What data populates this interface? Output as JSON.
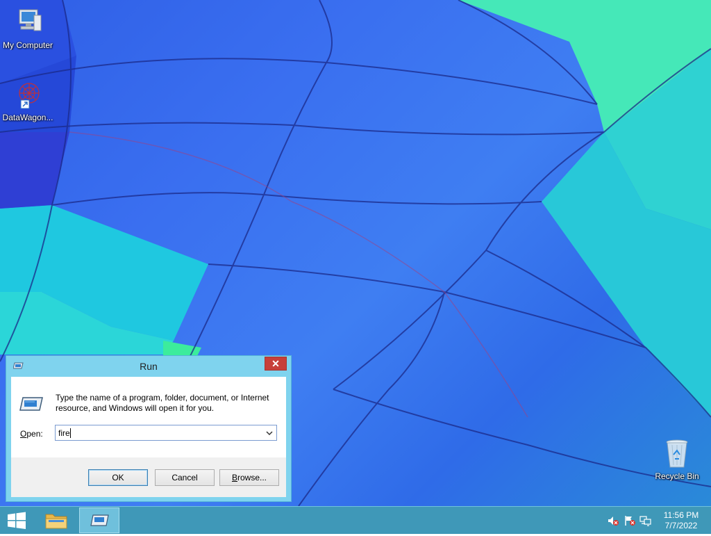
{
  "desktop": {
    "icons": [
      {
        "label": "My Computer"
      },
      {
        "label": "DataWagon..."
      },
      {
        "label": "Recycle Bin"
      }
    ]
  },
  "run_dialog": {
    "title": "Run",
    "close_glyph": "✕",
    "description": "Type the name of a program, folder, document, or Internet resource, and Windows will open it for you.",
    "open_label_first": "O",
    "open_label_rest": "pen:",
    "open_value": "fire",
    "ok_label": "OK",
    "cancel_label": "Cancel",
    "browse_label_first": "B",
    "browse_label_rest": "rowse..."
  },
  "taskbar": {
    "time": "11:56 PM",
    "date": "7/7/2022"
  }
}
